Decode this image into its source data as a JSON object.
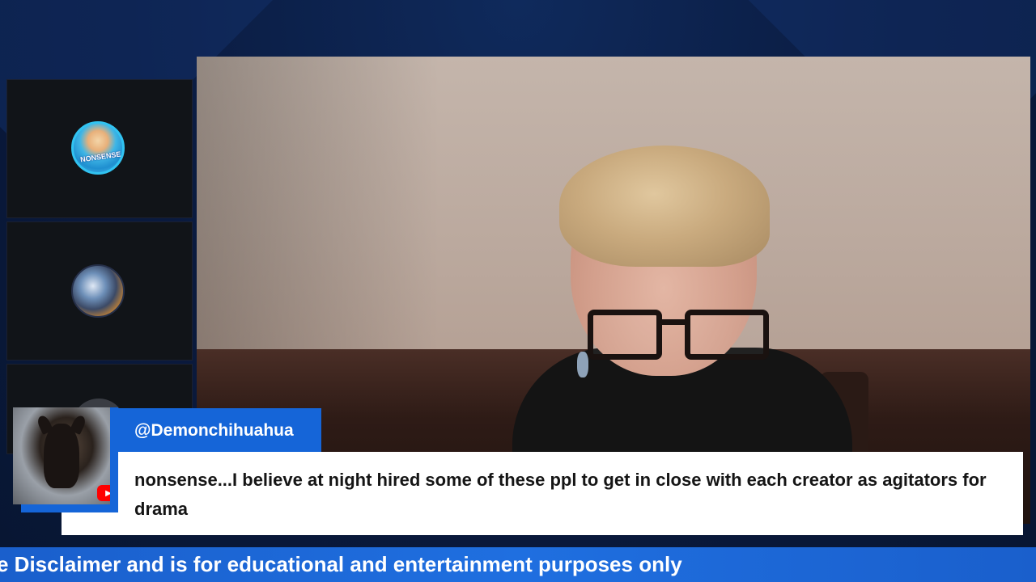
{
  "chat": {
    "username": "@Demonchihuahua",
    "message": "nonsense...I believe at night hired some of these ppl to get in close with each creator as agitators for drama",
    "platform_icon": "youtube-icon"
  },
  "ticker": {
    "text": "e Disclaimer and is for educational and entertainment purposes only"
  },
  "participants": [
    {
      "avatar_label": "NONSENSE",
      "icon": "avatar-icon"
    },
    {
      "icon": "avatar-icon"
    },
    {
      "icon": "avatar-icon"
    }
  ],
  "colors": {
    "accent_blue": "#1565d8",
    "background_navy": "#0a1a3a",
    "message_bg": "#ffffff",
    "youtube_red": "#ff0000"
  }
}
